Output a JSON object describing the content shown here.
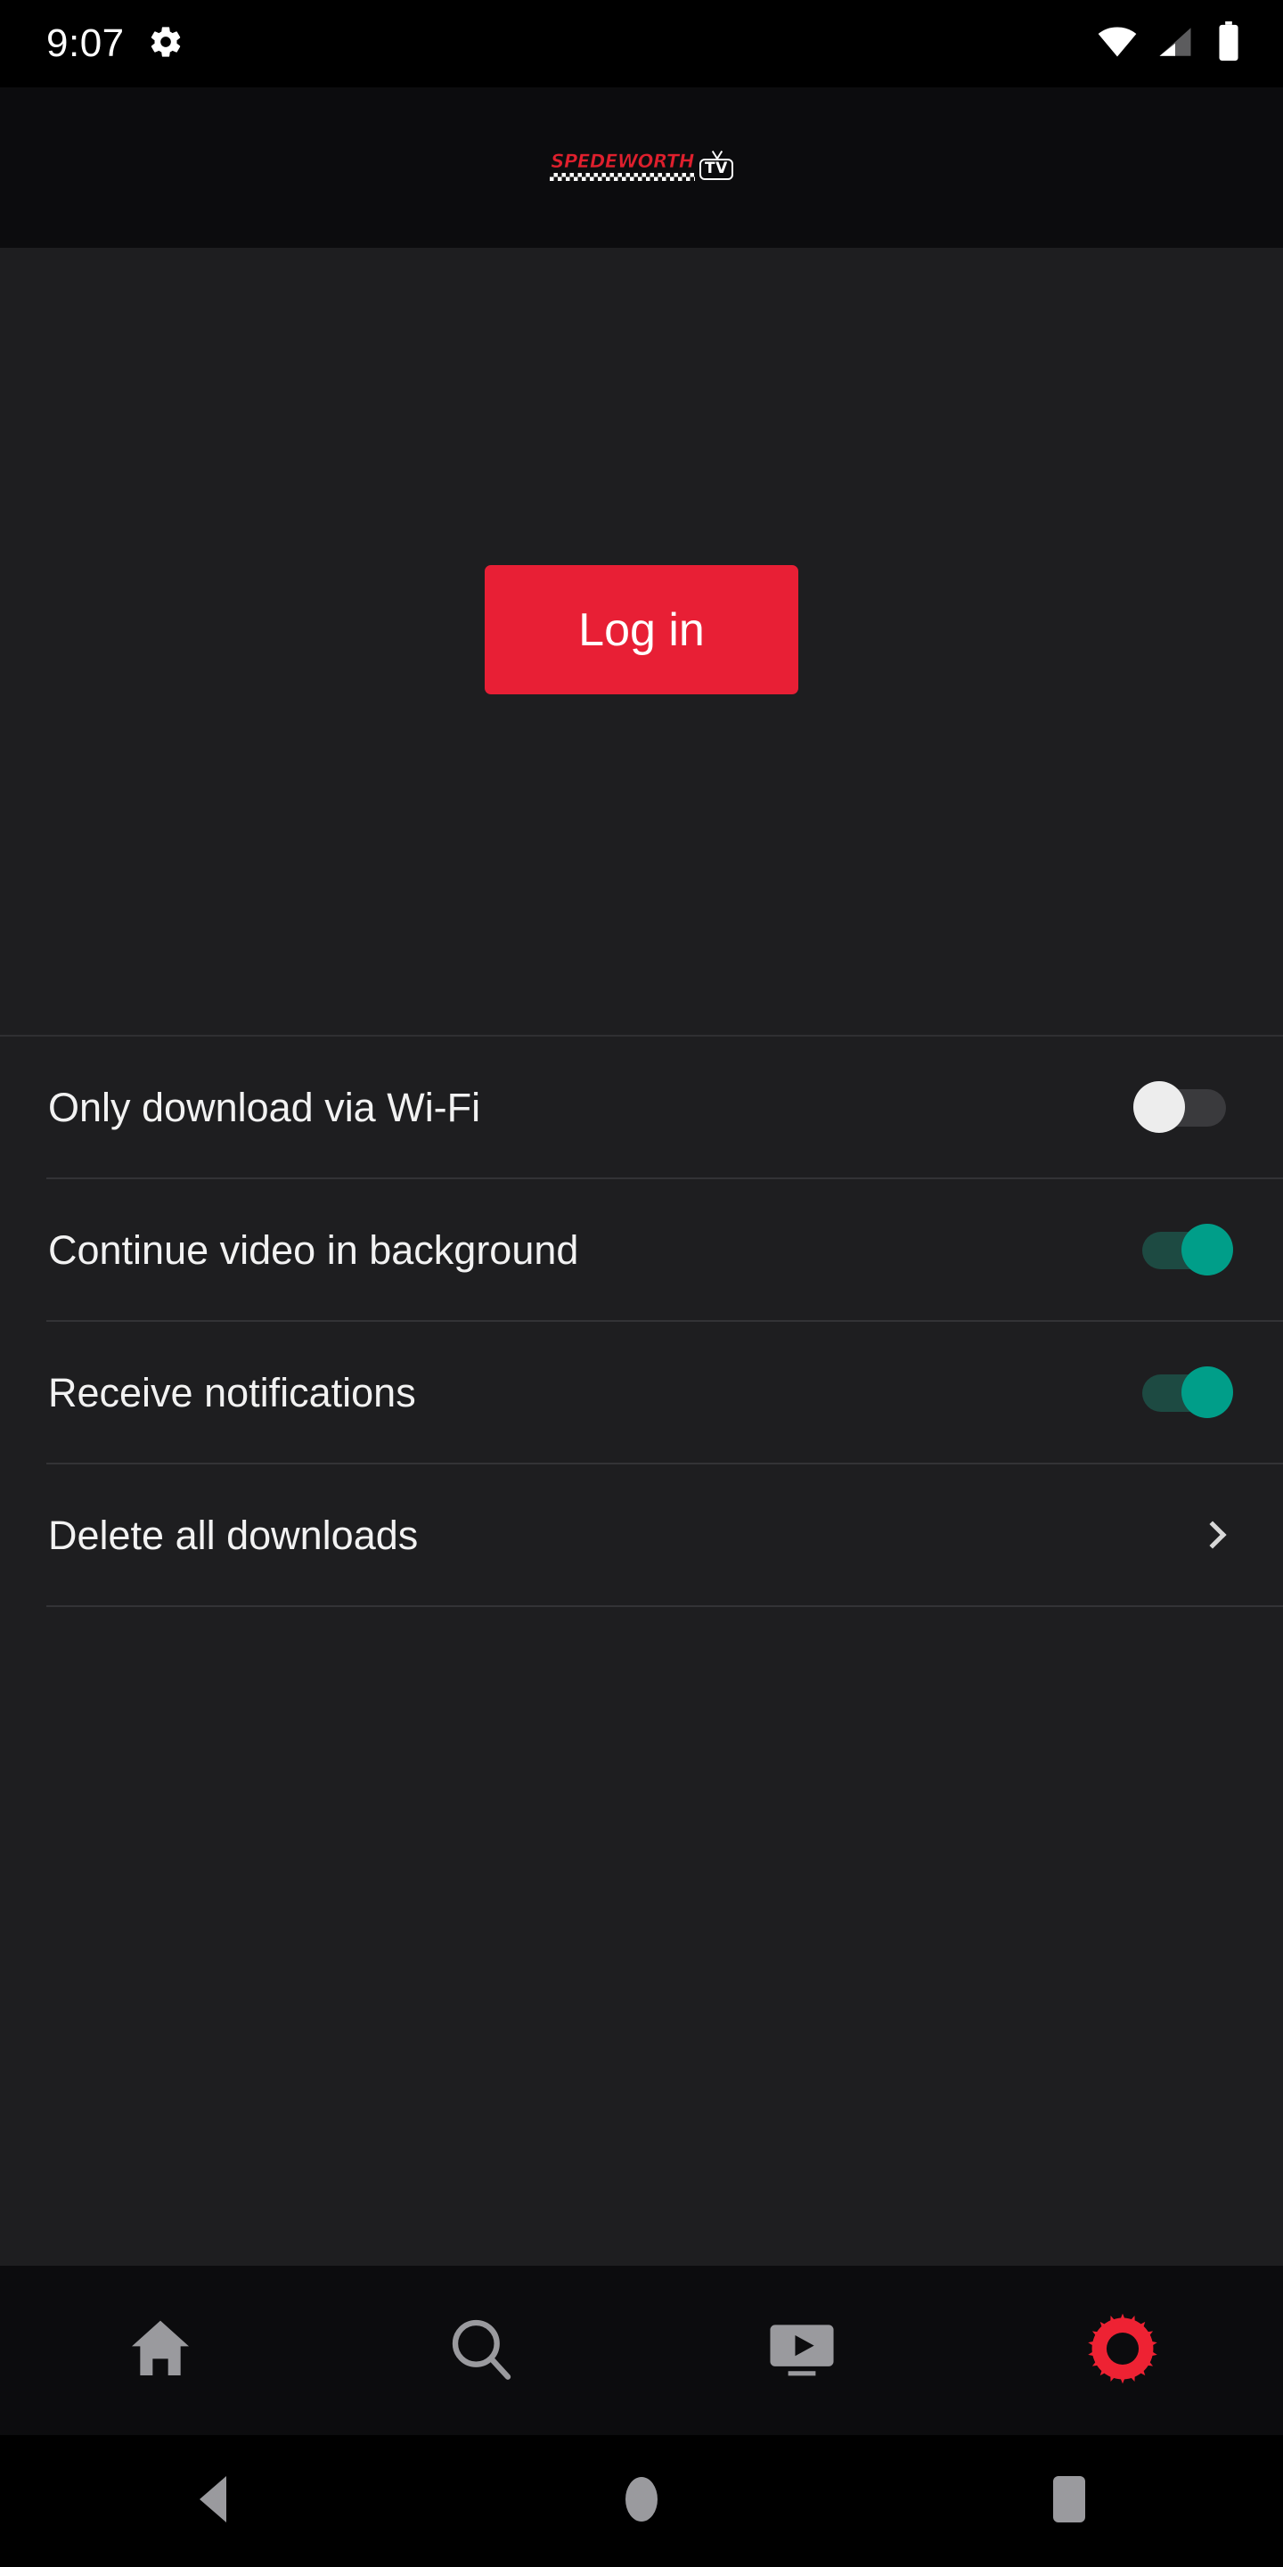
{
  "status_bar": {
    "clock": "9:07",
    "icons": [
      "gear-icon",
      "wifi-icon",
      "cellular-signal-icon",
      "battery-icon"
    ],
    "background": "#000000",
    "foreground": "#ffffff"
  },
  "app_header": {
    "logo_word": "SPEDEWORTH",
    "logo_tv_text": "TV",
    "logo_word_color": "#e01f2d",
    "background": "#0c0c0e"
  },
  "main": {
    "login_button_label": "Log in",
    "login_button_color": "#e81f35",
    "login_button_text_color": "#ffffff",
    "background": "#1e1e20"
  },
  "settings": {
    "rows": [
      {
        "label": "Only download via Wi-Fi",
        "control": "toggle",
        "state": "off",
        "name": "only-download-via-wifi"
      },
      {
        "label": "Continue video in background",
        "control": "toggle",
        "state": "on",
        "name": "continue-video-in-background"
      },
      {
        "label": "Receive notifications",
        "control": "toggle",
        "state": "on",
        "name": "receive-notifications"
      },
      {
        "label": "Delete all downloads",
        "control": "chevron",
        "state": "",
        "name": "delete-all-downloads"
      }
    ],
    "toggle_on_color": "#009e89",
    "toggle_on_track_color": "#1d4a42",
    "toggle_off_color": "#ededed",
    "toggle_off_track_color": "#3a3a3d",
    "label_color": "#f2f2f2",
    "divider_color": "#333336"
  },
  "tab_bar": {
    "active_color": "#ee2233",
    "inactive_color": "#9a9a9e",
    "background": "#0c0c0e",
    "items": [
      {
        "name": "tab-home",
        "icon": "home-icon",
        "active": false
      },
      {
        "name": "tab-search",
        "icon": "search-icon",
        "active": false
      },
      {
        "name": "tab-videos",
        "icon": "tv-play-icon",
        "active": false
      },
      {
        "name": "tab-settings",
        "icon": "gear-icon",
        "active": true
      }
    ]
  },
  "android_nav": {
    "background": "#000000",
    "icon_color": "#9a9a9e",
    "items": [
      {
        "name": "android-back-button",
        "icon": "back-triangle-icon"
      },
      {
        "name": "android-home-button",
        "icon": "home-circle-icon"
      },
      {
        "name": "android-recents-button",
        "icon": "recents-square-icon"
      }
    ]
  }
}
